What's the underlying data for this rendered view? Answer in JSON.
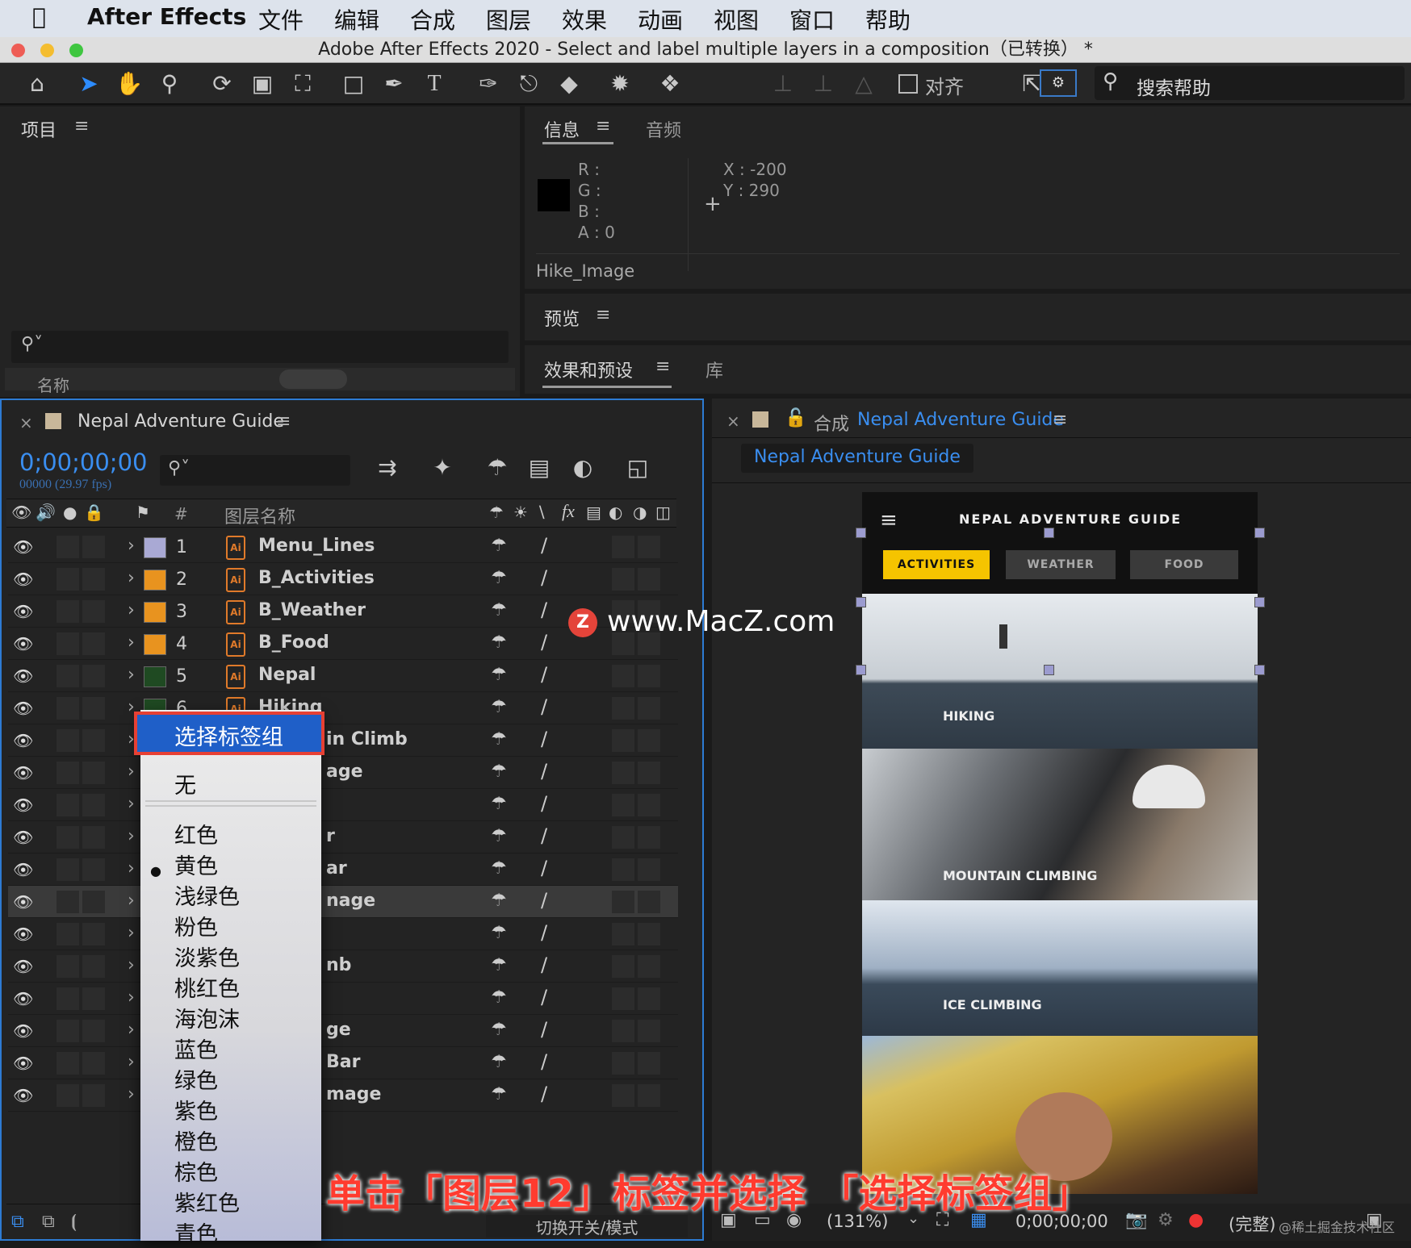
{
  "menubar": {
    "app": "After Effects",
    "items": [
      "文件",
      "编辑",
      "合成",
      "图层",
      "效果",
      "动画",
      "视图",
      "窗口",
      "帮助"
    ]
  },
  "window_title": "Adobe After Effects 2020 - Select and label multiple layers in a composition（已转换） *",
  "toolbar": {
    "align_label": "对齐",
    "search_help": "搜索帮助"
  },
  "project_panel": {
    "title": "项目",
    "column_name": "名称"
  },
  "info_panel": {
    "tab": "信息",
    "tab2": "音频",
    "r": "R :",
    "g": "G :",
    "b": "B :",
    "a": "A :  0",
    "x": "X : -200",
    "y": "Y :  290",
    "layer_name": "Hike_Image"
  },
  "preview_panel": {
    "title": "预览"
  },
  "effects_panel": {
    "title": "效果和预设",
    "tab2": "库"
  },
  "timeline": {
    "comp_name": "Nepal Adventure Guide",
    "timecode": "0;00;00;00",
    "frames": "00000 (29.97 fps)",
    "col_num": "#",
    "col_name": "图层名称",
    "footer": "切换开关/模式",
    "layers": [
      {
        "num": "1",
        "name": "Menu_Lines",
        "color": "#a9a9d4"
      },
      {
        "num": "2",
        "name": "B_Activities",
        "color": "#e8931f"
      },
      {
        "num": "3",
        "name": "B_Weather",
        "color": "#e8931f"
      },
      {
        "num": "4",
        "name": "B_Food",
        "color": "#e8931f"
      },
      {
        "num": "5",
        "name": "Nepal",
        "color": "#1f4a22"
      },
      {
        "num": "6",
        "name": "Hiking",
        "color": "#1f4a22"
      },
      {
        "num": "",
        "name": "in Climb",
        "color": ""
      },
      {
        "num": "",
        "name": "age",
        "color": ""
      },
      {
        "num": "",
        "name": "",
        "color": ""
      },
      {
        "num": "",
        "name": "r",
        "color": ""
      },
      {
        "num": "",
        "name": "ar",
        "color": ""
      },
      {
        "num": "",
        "name": "nage",
        "color": ""
      },
      {
        "num": "",
        "name": "",
        "color": ""
      },
      {
        "num": "",
        "name": "nb",
        "color": ""
      },
      {
        "num": "",
        "name": "",
        "color": ""
      },
      {
        "num": "",
        "name": "ge",
        "color": ""
      },
      {
        "num": "",
        "name": "Bar",
        "color": ""
      },
      {
        "num": "",
        "name": "mage",
        "color": ""
      }
    ]
  },
  "context_menu": {
    "highlight": "选择标签组",
    "items": [
      "无",
      "红色",
      "黄色",
      "浅绿色",
      "粉色",
      "淡紫色",
      "桃红色",
      "海泡沫",
      "蓝色",
      "绿色",
      "紫色",
      "橙色",
      "棕色",
      "紫红色",
      "青色"
    ],
    "checked": "淡紫色"
  },
  "composition": {
    "prefix": "合成",
    "name": "Nepal Adventure Guide",
    "tab": "Nepal Adventure Guide",
    "zoom": "(131%)",
    "timecode": "0;00;00;00",
    "quality": "(完整)",
    "app_title": "NEPAL ADVENTURE GUIDE",
    "buttons": [
      "ACTIVITIES",
      "WEATHER",
      "FOOD"
    ],
    "sections": [
      "HIKING",
      "MOUNTAIN CLIMBING",
      "ICE CLIMBING"
    ]
  },
  "watermark": "www.MacZ.com",
  "caption": "单击「图层12」标签并选择 「选择标签组」",
  "small_watermark": "@稀土掘金技术社区"
}
